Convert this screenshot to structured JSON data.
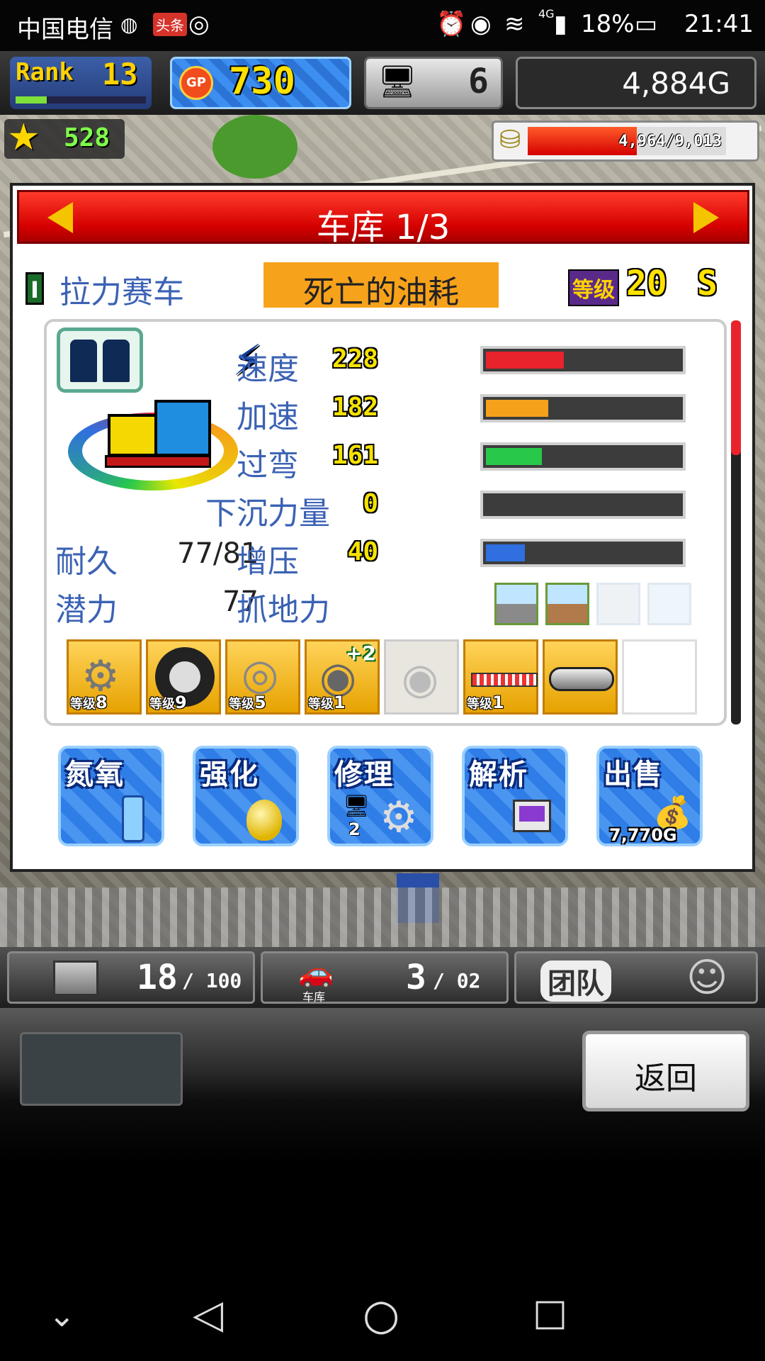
{
  "status_bar": {
    "carrier": "中国电信",
    "news_badge": "头条",
    "network": "4G",
    "battery": "18%",
    "time": "21:41"
  },
  "hud": {
    "rank_label": "Rank",
    "rank_value": "13",
    "gp_label": "GP",
    "gp_value": "730",
    "computer_count": "6",
    "money": "4,884G",
    "star_count": "528",
    "fuel": "4,964/9,013"
  },
  "dialog": {
    "title": "车库 1/3",
    "class_letter": "I",
    "car_type": "拉力赛车",
    "car_name": "死亡的油耗",
    "level_label": "等级",
    "level_value": "20",
    "grade": "S",
    "stats": [
      {
        "label": "速度",
        "value": "228",
        "fill": 0.4,
        "color": "#e8232b"
      },
      {
        "label": "加速",
        "value": "182",
        "fill": 0.32,
        "color": "#f5a21a"
      },
      {
        "label": "过弯",
        "value": "161",
        "fill": 0.29,
        "color": "#28c94a"
      },
      {
        "label": "下沉力量",
        "value": "0",
        "fill": 0.0,
        "color": "#888888"
      },
      {
        "label": "增压",
        "value": "40",
        "fill": 0.2,
        "color": "#2f6fe0"
      }
    ],
    "durability_label": "耐久",
    "durability_value": "77/81",
    "potential_label": "潜力",
    "potential_value": "77",
    "grip_label": "抓地力",
    "parts": [
      {
        "icon": "engine-icon",
        "level_label": "等级",
        "level": "8"
      },
      {
        "icon": "tire-icon",
        "level_label": "等级",
        "level": "9"
      },
      {
        "icon": "brake-icon",
        "level_label": "等级",
        "level": "5"
      },
      {
        "icon": "turbo-icon",
        "level_label": "等级",
        "level": "1",
        "bonus": "+2"
      },
      {
        "icon": "turbo-empty-icon",
        "level_label": "",
        "level": ""
      },
      {
        "icon": "suspension-icon",
        "level_label": "等级",
        "level": "1"
      },
      {
        "icon": "muffler-icon",
        "level_label": "",
        "level": ""
      },
      {
        "icon": "empty-slot",
        "level_label": "",
        "level": ""
      }
    ],
    "actions": [
      {
        "label": "氮氧",
        "sub": ""
      },
      {
        "label": "强化",
        "sub": ""
      },
      {
        "label": "修理",
        "sub": "2"
      },
      {
        "label": "解析",
        "sub": ""
      },
      {
        "label": "出售",
        "sub": "7,770G"
      }
    ]
  },
  "bottom_hud": {
    "parts_count": "18",
    "parts_max": "/ 100",
    "garage_label": "车库",
    "garage_count": "3",
    "garage_max": "/ 02",
    "team_label": "团队"
  },
  "bottom_panel": {
    "back_label": "返回"
  }
}
